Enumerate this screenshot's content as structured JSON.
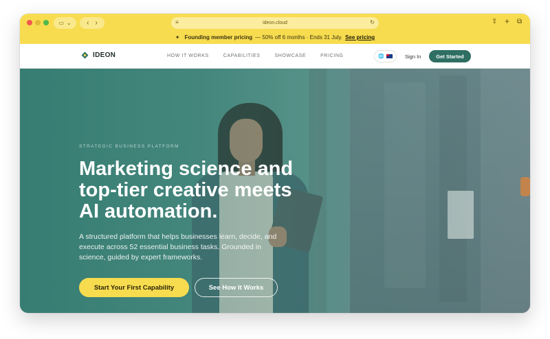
{
  "browser": {
    "url": "ideon.cloud",
    "icons": [
      "sidebar-icon",
      "chevron-down-icon",
      "back-icon",
      "forward-icon",
      "site-settings-icon",
      "reload-icon",
      "share-icon",
      "new-tab-icon",
      "tabs-overview-icon"
    ],
    "glyphs": {
      "sidebar": "▭",
      "chevron": "⌄",
      "back": "‹",
      "forward": "›",
      "site": "≡",
      "reload": "↻",
      "share": "⇪",
      "new_tab": "+",
      "tabs": "⧉"
    }
  },
  "promo": {
    "icon": "✦",
    "title": "Founding member pricing",
    "detail": "— 50% off 6 months · Ends 31 July.",
    "link": "See pricing"
  },
  "header": {
    "brand": "IDEON",
    "nav": [
      "HOW IT WORKS",
      "CAPABILITIES",
      "SHOWCASE",
      "PRICING"
    ],
    "lang_icon": "🌐",
    "sign_in": "Sign In",
    "cta": "Get Started"
  },
  "hero": {
    "eyebrow": "STRATEGIC BUSINESS PLATFORM",
    "headline": "Marketing science and top-tier creative meets AI automation.",
    "subtext": "A structured platform that helps businesses learn, decide, and execute across 52 essential business tasks. Grounded in science, guided by expert frameworks.",
    "primary_cta": "Start Your First Capability",
    "secondary_cta": "See How It Works"
  },
  "colors": {
    "brand_yellow": "#f7dc4f",
    "brand_teal": "#2f6f63"
  }
}
